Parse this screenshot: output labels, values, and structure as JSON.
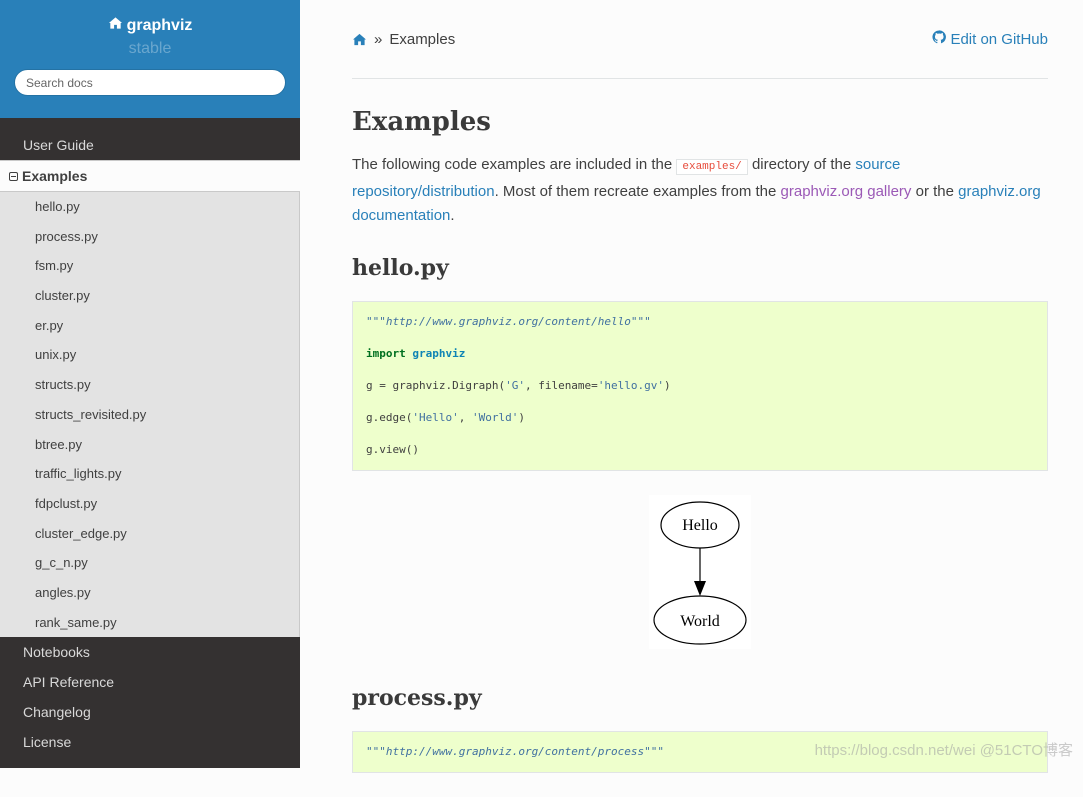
{
  "sidebar": {
    "project": "graphviz",
    "version": "stable",
    "search_placeholder": "Search docs",
    "nav_top": [
      {
        "label": "User Guide"
      }
    ],
    "current": {
      "label": "Examples"
    },
    "sub_items": [
      {
        "label": "hello.py"
      },
      {
        "label": "process.py"
      },
      {
        "label": "fsm.py"
      },
      {
        "label": "cluster.py"
      },
      {
        "label": "er.py"
      },
      {
        "label": "unix.py"
      },
      {
        "label": "structs.py"
      },
      {
        "label": "structs_revisited.py"
      },
      {
        "label": "btree.py"
      },
      {
        "label": "traffic_lights.py"
      },
      {
        "label": "fdpclust.py"
      },
      {
        "label": "cluster_edge.py"
      },
      {
        "label": "g_c_n.py"
      },
      {
        "label": "angles.py"
      },
      {
        "label": "rank_same.py"
      }
    ],
    "nav_bottom": [
      {
        "label": "Notebooks"
      },
      {
        "label": "API Reference"
      },
      {
        "label": "Changelog"
      },
      {
        "label": "License"
      }
    ]
  },
  "breadcrumb": {
    "separator": "»",
    "current": "Examples",
    "edit_link": "Edit on GitHub"
  },
  "page": {
    "title": "Examples",
    "intro": {
      "t1": "The following code examples are included in the ",
      "code": "examples/",
      "t2": " directory of the ",
      "link1": "source repository/distribution",
      "t3": ". Most of them recreate examples from the ",
      "link2": "graphviz.org gallery",
      "t4": " or the ",
      "link3": "graphviz.org documentation",
      "t5": "."
    },
    "sections": [
      {
        "title": "hello.py",
        "code": {
          "docstring": "\"\"\"http://www.graphviz.org/content/hello\"\"\"",
          "import_kw": "import",
          "import_mod": "graphviz",
          "l3a": "g = graphviz.Digraph(",
          "l3s1": "'G'",
          "l3b": ", filename=",
          "l3s2": "'hello.gv'",
          "l3c": ")",
          "l4a": "g.edge(",
          "l4s1": "'Hello'",
          "l4b": ", ",
          "l4s2": "'World'",
          "l4c": ")",
          "l5": "g.view()"
        },
        "graph": {
          "nodes": [
            "Hello",
            "World"
          ],
          "edges": [
            [
              "Hello",
              "World"
            ]
          ]
        }
      },
      {
        "title": "process.py",
        "code": {
          "docstring": "\"\"\"http://www.graphviz.org/content/process\"\"\""
        }
      }
    ]
  },
  "watermark": "https://blog.csdn.net/wei @51CTO博客"
}
